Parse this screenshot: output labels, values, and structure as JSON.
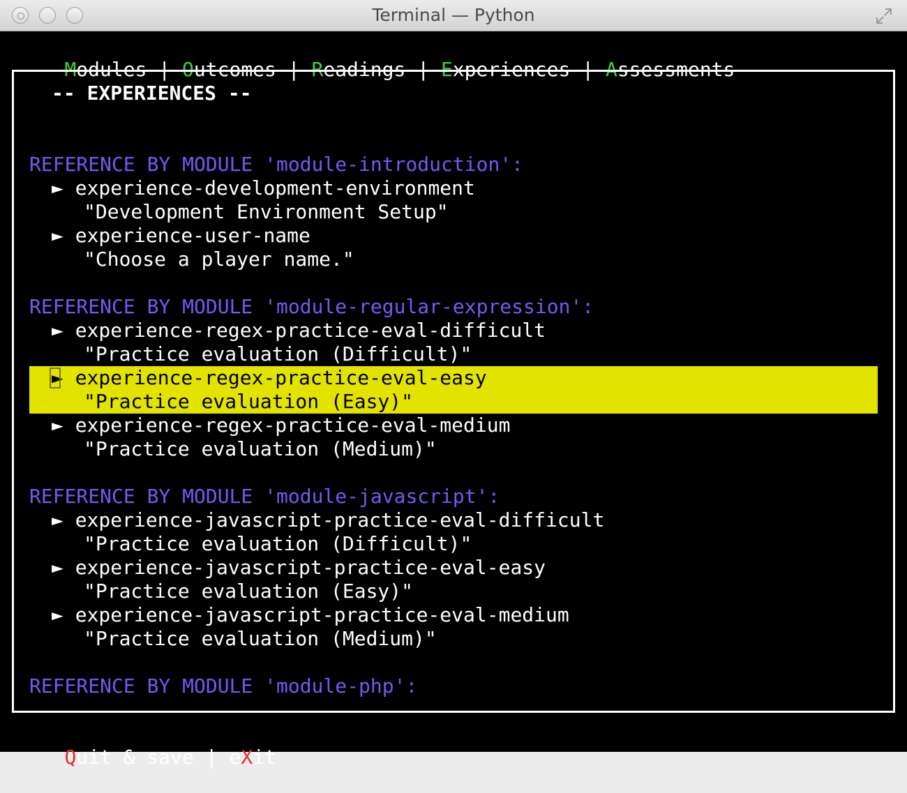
{
  "window": {
    "title": "Terminal — Python"
  },
  "menu": {
    "items": [
      {
        "hotkey": "M",
        "rest": "odules"
      },
      {
        "hotkey": "O",
        "rest": "utcomes"
      },
      {
        "hotkey": "R",
        "rest": "eadings"
      },
      {
        "hotkey": "E",
        "rest": "xperiences"
      },
      {
        "hotkey": "A",
        "rest": "ssessments"
      }
    ],
    "separator": " | "
  },
  "panel": {
    "title": "-- EXPERIENCES --"
  },
  "arrow": "►",
  "groups": [
    {
      "header": "REFERENCE BY MODULE 'module-introduction':",
      "items": [
        {
          "id": "experience-development-environment",
          "desc": "\"Development Environment Setup\""
        },
        {
          "id": "experience-user-name",
          "desc": "\"Choose a player name.\""
        }
      ]
    },
    {
      "header": "REFERENCE BY MODULE 'module-regular-expression':",
      "items": [
        {
          "id": "experience-regex-practice-eval-difficult",
          "desc": "\"Practice evaluation (Difficult)\""
        },
        {
          "id": "experience-regex-practice-eval-easy",
          "desc": "\"Practice evaluation (Easy)\"",
          "selected": true
        },
        {
          "id": "experience-regex-practice-eval-medium",
          "desc": "\"Practice evaluation (Medium)\""
        }
      ]
    },
    {
      "header": "REFERENCE BY MODULE 'module-javascript':",
      "items": [
        {
          "id": "experience-javascript-practice-eval-difficult",
          "desc": "\"Practice evaluation (Difficult)\""
        },
        {
          "id": "experience-javascript-practice-eval-easy",
          "desc": "\"Practice evaluation (Easy)\""
        },
        {
          "id": "experience-javascript-practice-eval-medium",
          "desc": "\"Practice evaluation (Medium)\""
        }
      ]
    },
    {
      "header": "REFERENCE BY MODULE 'module-php':",
      "items": []
    }
  ],
  "footer": {
    "quit": {
      "hotkey": "Q",
      "rest": "uit & save"
    },
    "separator": " | ",
    "exit": {
      "pre": "e",
      "hotkey": "X",
      "rest": "it"
    }
  },
  "colors": {
    "hotkey": "#3cd23c",
    "footer_hotkey": "#e0332b",
    "reference_header": "#6f5cf2",
    "selection": "#e3e300"
  }
}
